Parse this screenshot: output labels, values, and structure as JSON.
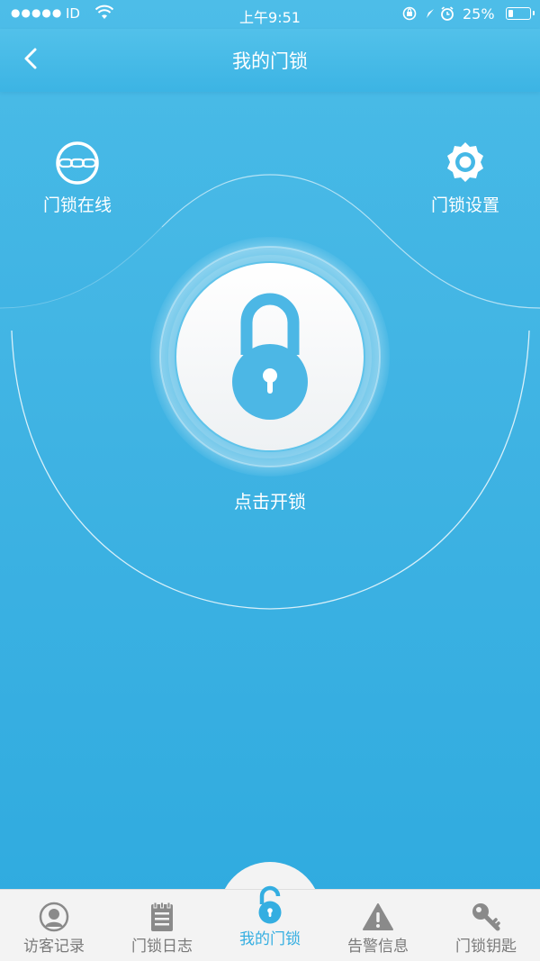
{
  "status_bar": {
    "carrier": "ID",
    "time": "上午9:51",
    "battery_percent": "25%",
    "battery_level": 0.25
  },
  "nav": {
    "title": "我的门锁",
    "back_icon": "chevron-left-icon"
  },
  "features": {
    "online_label": "门锁在线",
    "settings_label": "门锁设置"
  },
  "unlock": {
    "label": "点击开锁",
    "icon": "padlock-icon"
  },
  "tabs": [
    {
      "label": "访客记录",
      "icon": "user-circle-icon",
      "active": false
    },
    {
      "label": "门锁日志",
      "icon": "notepad-icon",
      "active": false
    },
    {
      "label": "我的门锁",
      "icon": "unlocked-padlock-icon",
      "active": true
    },
    {
      "label": "告警信息",
      "icon": "warning-icon",
      "active": false
    },
    {
      "label": "门锁钥匙",
      "icon": "key-icon",
      "active": false
    }
  ],
  "colors": {
    "primary": "#3cb4e4",
    "active_tab": "#34aee1",
    "inactive_tab": "#7a7a7a",
    "tab_bar_bg": "#f3f3f3"
  }
}
